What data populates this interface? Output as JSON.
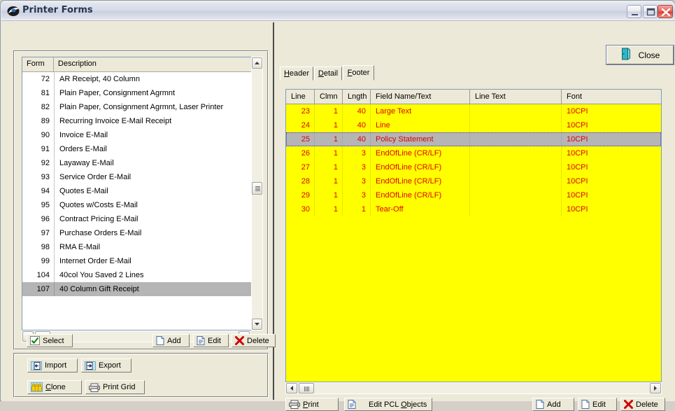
{
  "window": {
    "title": "Printer Forms",
    "icon": "printer-forms-icon",
    "minimize_label": "Minimize",
    "maximize_label": "Maximize",
    "close_label": "Close"
  },
  "left": {
    "list": {
      "columns": [
        "Form",
        "Description"
      ],
      "rows": [
        {
          "form": "72",
          "description": "AR Receipt, 40 Column"
        },
        {
          "form": "81",
          "description": "Plain Paper, Consignment Agrmnt"
        },
        {
          "form": "82",
          "description": "Plain Paper, Consignment Agrmnt, Laser Printer"
        },
        {
          "form": "89",
          "description": "Recurring Invoice E-Mail Receipt"
        },
        {
          "form": "90",
          "description": "Invoice E-Mail"
        },
        {
          "form": "91",
          "description": "Orders E-Mail"
        },
        {
          "form": "92",
          "description": "Layaway E-Mail"
        },
        {
          "form": "93",
          "description": "Service Order E-Mail"
        },
        {
          "form": "94",
          "description": "Quotes E-Mail"
        },
        {
          "form": "95",
          "description": "Quotes w/Costs E-Mail"
        },
        {
          "form": "96",
          "description": "Contract Pricing E-Mail"
        },
        {
          "form": "97",
          "description": "Purchase Orders E-Mail"
        },
        {
          "form": "98",
          "description": "RMA E-Mail"
        },
        {
          "form": "99",
          "description": "Internet Order E-Mail"
        },
        {
          "form": "104",
          "description": "40col You Saved 2 Lines"
        },
        {
          "form": "107",
          "description": "40 Column Gift Receipt",
          "selected": true
        }
      ]
    },
    "buttons": {
      "select": "Select",
      "add": "Add",
      "edit": "Edit",
      "delete": "Delete",
      "import": "Import",
      "export": "Export",
      "clone": "Clone",
      "print_grid": "Print Grid"
    }
  },
  "right": {
    "close_button": "Close",
    "tabs": [
      {
        "label": "Header",
        "accel": "H",
        "active": false
      },
      {
        "label": "Detail",
        "accel": "D",
        "active": false
      },
      {
        "label": "Footer",
        "accel": "F",
        "active": true
      }
    ],
    "grid": {
      "columns": [
        "Line",
        "Clmn",
        "Lngth",
        "Field Name/Text",
        "Line Text",
        "Font"
      ],
      "rows": [
        {
          "line": "23",
          "clmn": "1",
          "lngth": "40",
          "field": "Large Text",
          "line_text": "",
          "font": "10CPI"
        },
        {
          "line": "24",
          "clmn": "1",
          "lngth": "40",
          "field": "Line",
          "line_text": "",
          "font": "10CPI"
        },
        {
          "line": "25",
          "clmn": "1",
          "lngth": "40",
          "field": "Policy Statement",
          "line_text": "",
          "font": "10CPI",
          "selected": true
        },
        {
          "line": "26",
          "clmn": "1",
          "lngth": "3",
          "field": "EndOfLine (CR/LF)",
          "line_text": "",
          "font": "10CPI"
        },
        {
          "line": "27",
          "clmn": "1",
          "lngth": "3",
          "field": "EndOfLine (CR/LF)",
          "line_text": "",
          "font": "10CPI"
        },
        {
          "line": "28",
          "clmn": "1",
          "lngth": "3",
          "field": "EndOfLine (CR/LF)",
          "line_text": "",
          "font": "10CPI"
        },
        {
          "line": "29",
          "clmn": "1",
          "lngth": "3",
          "field": "EndOfLine (CR/LF)",
          "line_text": "",
          "font": "10CPI"
        },
        {
          "line": "30",
          "clmn": "1",
          "lngth": "1",
          "field": "Tear-Off",
          "line_text": "",
          "font": "10CPI"
        }
      ]
    },
    "buttons": {
      "print": "Print",
      "print_accel": "P",
      "edit_pcl": "Edit PCL ",
      "edit_pcl_accel": "O",
      "edit_pcl_tail": "bjects",
      "add": "Add",
      "edit": "Edit",
      "delete": "Delete"
    }
  },
  "colors": {
    "grid_background": "#ffff00",
    "grid_text": "#e00000",
    "selection": "#b5b5b5",
    "window_face": "#ece9d8",
    "title_text": "#27364f"
  }
}
